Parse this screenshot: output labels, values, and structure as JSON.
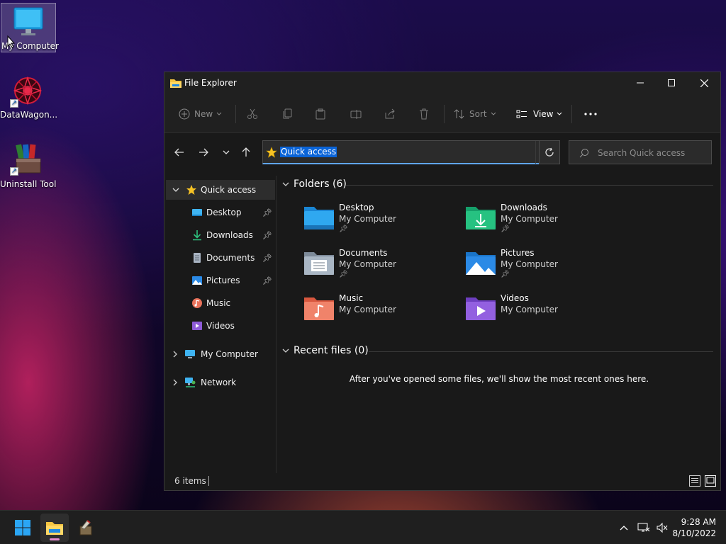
{
  "desktop": {
    "icons": [
      {
        "label": "My Computer"
      },
      {
        "label": "DataWagon..."
      },
      {
        "label": "Uninstall Tool"
      }
    ]
  },
  "explorer": {
    "title": "File Explorer",
    "toolbar": {
      "new_label": "New",
      "sort_label": "Sort",
      "view_label": "View"
    },
    "address": {
      "value": "Quick access"
    },
    "search": {
      "placeholder": "Search Quick access"
    },
    "sidebar": {
      "items": [
        {
          "label": "Quick access"
        },
        {
          "label": "Desktop"
        },
        {
          "label": "Downloads"
        },
        {
          "label": "Documents"
        },
        {
          "label": "Pictures"
        },
        {
          "label": "Music"
        },
        {
          "label": "Videos"
        },
        {
          "label": "My Computer"
        },
        {
          "label": "Network"
        }
      ]
    },
    "folders_header": "Folders (6)",
    "folders": [
      {
        "name": "Desktop",
        "location": "My Computer"
      },
      {
        "name": "Downloads",
        "location": "My Computer"
      },
      {
        "name": "Documents",
        "location": "My Computer"
      },
      {
        "name": "Pictures",
        "location": "My Computer"
      },
      {
        "name": "Music",
        "location": "My Computer"
      },
      {
        "name": "Videos",
        "location": "My Computer"
      }
    ],
    "recent_header": "Recent files (0)",
    "recent_empty": "After you've opened some files, we'll show the most recent ones here.",
    "status": {
      "count": "6 items"
    }
  },
  "taskbar": {
    "time": "9:28 AM",
    "date": "8/10/2022"
  },
  "colors": {
    "accent": "#0a64d8",
    "window_bg": "#191919",
    "taskbar_bg": "#1f1f1f"
  }
}
